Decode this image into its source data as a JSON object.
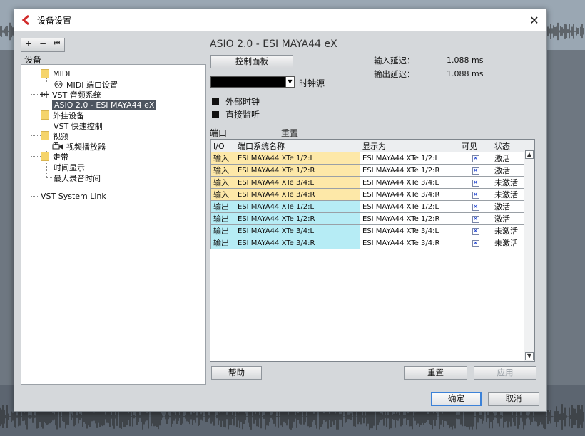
{
  "window": {
    "title": "设备设置",
    "close_glyph": "✕"
  },
  "toolbar": {
    "add_glyph": "+",
    "remove_glyph": "−",
    "reset_glyph": "⏮"
  },
  "sidebar": {
    "label": "设备",
    "items": [
      {
        "label": "MIDI",
        "icon": "folder-icon"
      },
      {
        "label": "MIDI 端口设置",
        "icon": "midi-port-icon"
      },
      {
        "label": "VST 音频系统",
        "icon": "audio-system-icon"
      },
      {
        "label": "ASIO 2.0 - ESI MAYA44 eX",
        "icon": "",
        "selected": true
      },
      {
        "label": "外挂设备",
        "icon": "folder-icon"
      },
      {
        "label": "VST 快速控制",
        "icon": ""
      },
      {
        "label": "视频",
        "icon": "folder-icon"
      },
      {
        "label": "视频播放器",
        "icon": "video-player-icon"
      },
      {
        "label": "走带",
        "icon": "folder-icon"
      },
      {
        "label": "时间显示",
        "icon": ""
      },
      {
        "label": "最大录音时间",
        "icon": ""
      },
      {
        "label": "VST System Link",
        "icon": ""
      }
    ]
  },
  "main": {
    "driver_title": "ASIO 2.0 - ESI MAYA44 eX",
    "control_panel_label": "控制面板",
    "input_latency_label": "输入延迟：",
    "input_latency_value": "1.088 ms",
    "output_latency_label": "输出延迟：",
    "output_latency_value": "1.088 ms",
    "clock_source_label": "时钟源",
    "clock_source_value": "",
    "external_clock_label": "外部时钟",
    "direct_monitor_label": "直接监听",
    "ports_label": "端口",
    "reset_link_label": "重置",
    "table": {
      "headers": [
        "I/O",
        "端口系统名称",
        "显示为",
        "可见",
        "状态"
      ],
      "rows": [
        {
          "io": "输入",
          "name": "ESI MAYA44 XTe 1/2:L",
          "display": "ESI MAYA44 XTe 1/2:L",
          "visible": "✕",
          "state": "激活",
          "kind": "in"
        },
        {
          "io": "输入",
          "name": "ESI MAYA44 XTe 1/2:R",
          "display": "ESI MAYA44 XTe 1/2:R",
          "visible": "✕",
          "state": "激活",
          "kind": "in"
        },
        {
          "io": "输入",
          "name": "ESI MAYA44 XTe 3/4:L",
          "display": "ESI MAYA44 XTe 3/4:L",
          "visible": "✕",
          "state": "未激活",
          "kind": "in"
        },
        {
          "io": "输入",
          "name": "ESI MAYA44 XTe 3/4:R",
          "display": "ESI MAYA44 XTe 3/4:R",
          "visible": "✕",
          "state": "未激活",
          "kind": "in"
        },
        {
          "io": "输出",
          "name": "ESI MAYA44 XTe 1/2:L",
          "display": "ESI MAYA44 XTe 1/2:L",
          "visible": "✕",
          "state": "激活",
          "kind": "out"
        },
        {
          "io": "输出",
          "name": "ESI MAYA44 XTe 1/2:R",
          "display": "ESI MAYA44 XTe 1/2:R",
          "visible": "✕",
          "state": "激活",
          "kind": "out"
        },
        {
          "io": "输出",
          "name": "ESI MAYA44 XTe 3/4:L",
          "display": "ESI MAYA44 XTe 3/4:L",
          "visible": "✕",
          "state": "未激活",
          "kind": "out"
        },
        {
          "io": "输出",
          "name": "ESI MAYA44 XTe 3/4:R",
          "display": "ESI MAYA44 XTe 3/4:R",
          "visible": "✕",
          "state": "未激活",
          "kind": "out"
        }
      ]
    },
    "help_label": "帮助",
    "reset_label": "重置",
    "apply_label": "应用"
  },
  "footer": {
    "ok_label": "确定",
    "cancel_label": "取消"
  },
  "colors": {
    "input_row": "#fde8a8",
    "output_row": "#b6ecf5",
    "selected_item": "#4d5560",
    "primary_border": "#3c82d8"
  }
}
